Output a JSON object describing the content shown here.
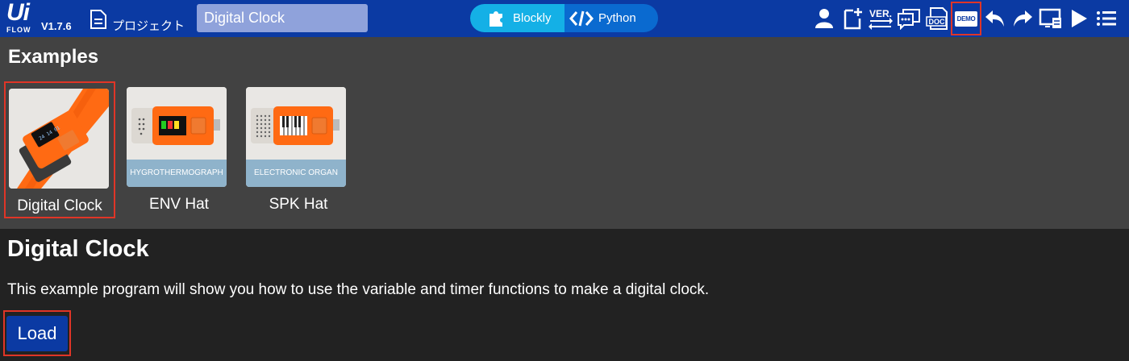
{
  "app": {
    "logo_top": "Ui",
    "logo_bottom": "FLOW",
    "version": "V1.7.6",
    "project_label": "プロジェクト",
    "project_name": "Digital Clock"
  },
  "mode_switch": {
    "blockly_label": "Blockly",
    "python_label": "Python",
    "active": "Blockly"
  },
  "toolbar": {
    "icons": [
      "user-icon",
      "new-file-icon",
      "version-icon",
      "chat-icon",
      "doc-icon",
      "demo-icon",
      "undo-icon",
      "redo-icon",
      "device-icon",
      "run-icon",
      "menu-icon"
    ],
    "ver_text": "VER.",
    "doc_text": "DOC",
    "demo_text": "DEMO"
  },
  "examples": {
    "title": "Examples",
    "items": [
      {
        "label": "Digital Clock",
        "caption": ""
      },
      {
        "label": "ENV Hat",
        "caption": "HYGROTHERMOGRAPH"
      },
      {
        "label": "SPK Hat",
        "caption": "ELECTRONIC ORGAN"
      }
    ],
    "selected": "Digital Clock"
  },
  "detail": {
    "title": "Digital Clock",
    "description": "This example program will show you how to use the variable and timer functions to make a digital clock.",
    "load_label": "Load"
  },
  "colors": {
    "topbar": "#0b3aa3",
    "highlight": "#e03527",
    "blockly_active": "#14b0e6",
    "device_orange": "#ff6a13"
  }
}
